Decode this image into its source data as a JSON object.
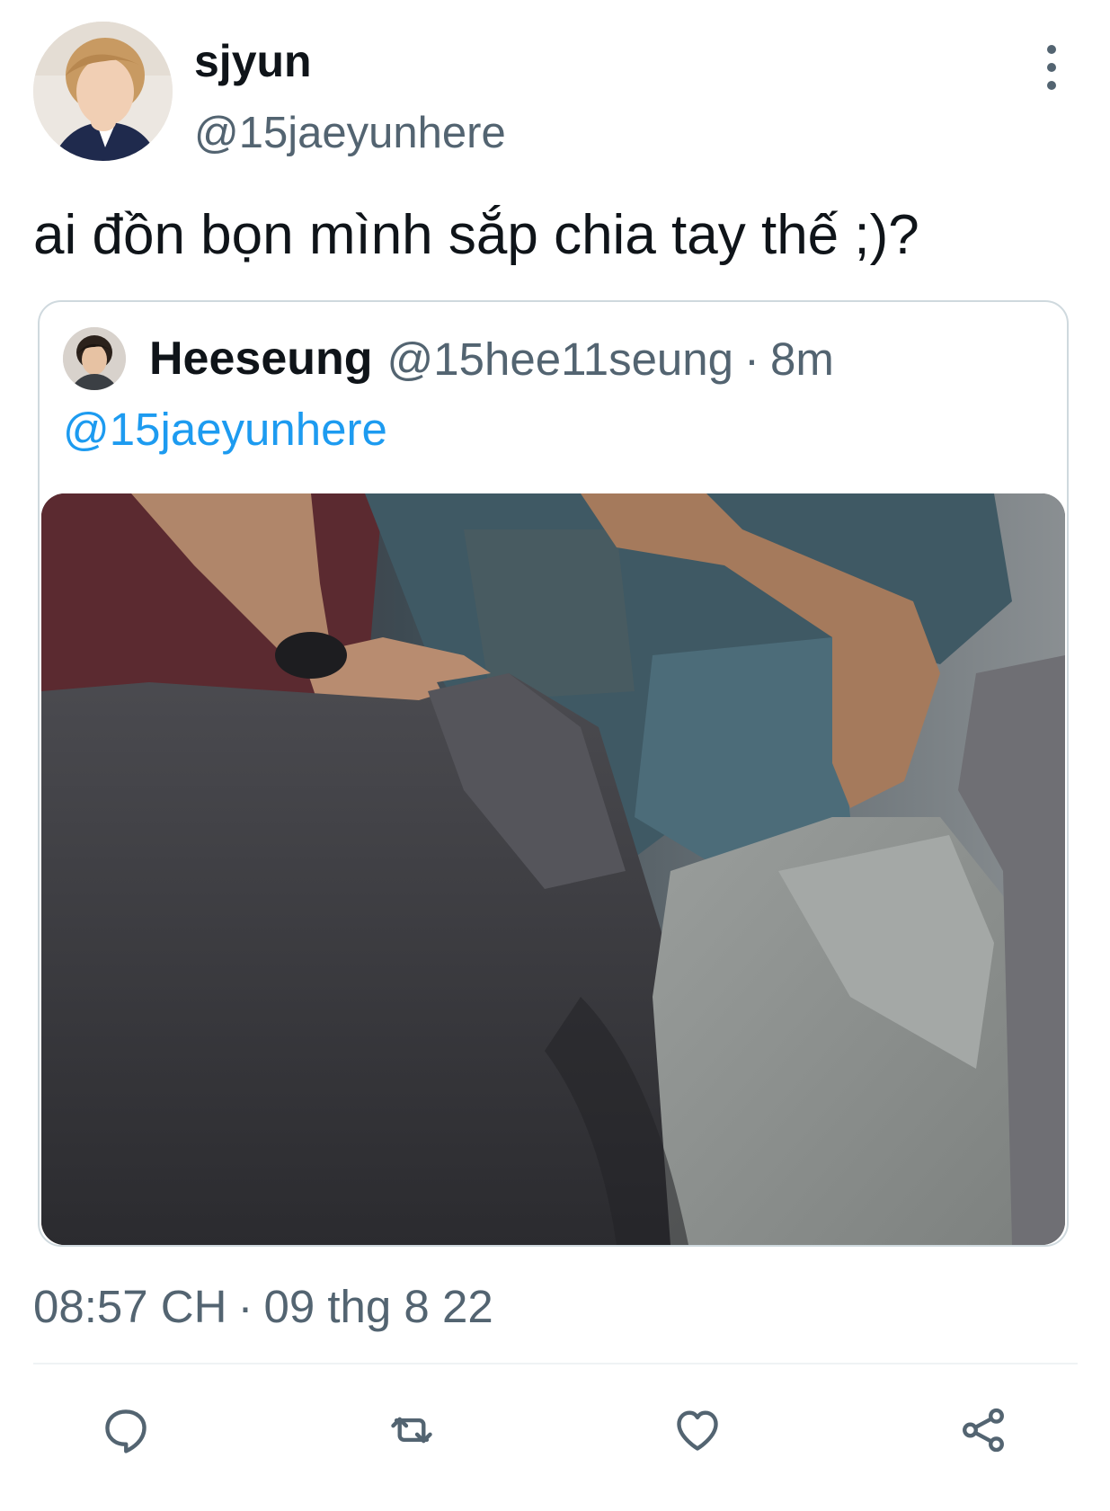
{
  "author": {
    "display_name": "sjyun",
    "handle": "@15jaeyunhere",
    "avatar": "profile-photo"
  },
  "tweet": {
    "text": "ai đồn bọn mình sắp chia tay thế ;)?"
  },
  "quoted_tweet": {
    "display_name": "Heeseung",
    "handle": "@15hee11seung",
    "separator": "·",
    "time": "8m",
    "mention": "@15jaeyunhere",
    "avatar": "profile-photo",
    "media": "photo"
  },
  "meta": {
    "time": "08:57 CH",
    "separator": "·",
    "date": "09 thg 8 22"
  },
  "actions": {
    "reply_icon": "reply-icon",
    "retweet_icon": "retweet-icon",
    "like_icon": "heart-icon",
    "share_icon": "share-icon",
    "more_icon": "more-vertical-icon"
  },
  "colors": {
    "text_primary": "#0f1419",
    "text_secondary": "#536471",
    "link": "#1d9bf0",
    "border": "#cfd9de"
  }
}
